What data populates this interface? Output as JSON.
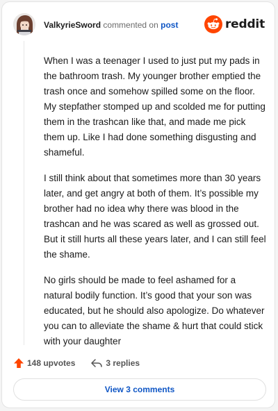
{
  "header": {
    "author": "ValkyrieSword",
    "verb": "commented on",
    "post_link": "post",
    "brand": "reddit",
    "brand_color": "#ff4500"
  },
  "comment": {
    "paragraphs": [
      "When I was a teenager I used to just put my pads in the bathroom trash. My younger brother emptied the trash once and somehow spilled some on the floor. My stepfather stomped up and scolded me for putting them in the trashcan like that, and made me pick them up. Like I had done something disgusting and shameful.",
      "I still think about that sometimes more than 30 years later, and get angry at both of them. It’s possible my brother had no idea why there was blood in the trashcan and he was scared as well as grossed out. But it still hurts all these years later, and I can still feel the shame.",
      "No girls should be made to feel ashamed for a natural bodily function. It’s good that your son was educated, but he should also apologize. Do whatever you can to alleviate the shame & hurt that could stick with your daughter"
    ]
  },
  "footer": {
    "upvotes": "148 upvotes",
    "replies": "3 replies",
    "upvote_icon": "upvote-arrow-icon",
    "reply_icon": "reply-arrow-icon"
  },
  "actions": {
    "view_comments": "View 3 comments"
  }
}
